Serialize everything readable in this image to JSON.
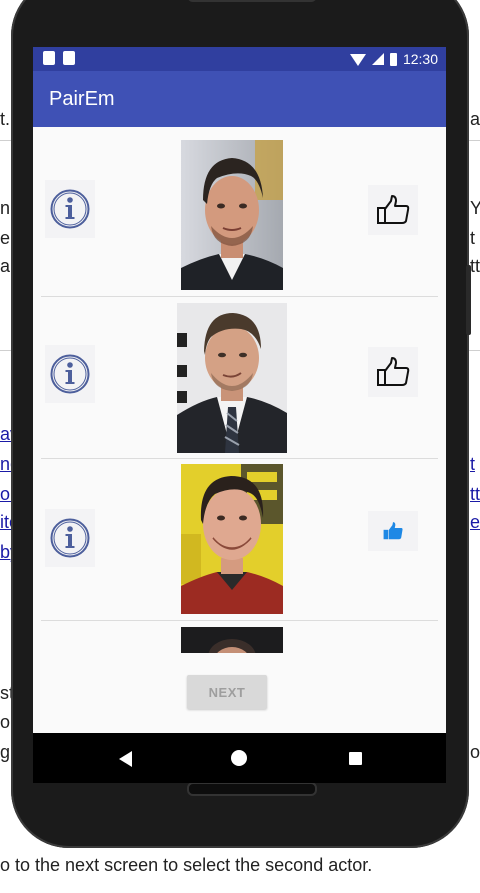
{
  "background_page": {
    "left_fragments": [
      "t.",
      "n",
      "ei",
      "a",
      "av",
      "ne",
      "or",
      "ite",
      "by",
      "st",
      "ou",
      "g"
    ],
    "right_fragments": [
      "a",
      "Y",
      "t",
      "tt",
      "t",
      "tte",
      "e",
      "or"
    ],
    "footer_caption": "o to the next screen to select the second actor."
  },
  "status_bar": {
    "time": "12:30",
    "color": "#303f9f"
  },
  "app_bar": {
    "title": "PairEm",
    "color": "#3f51b5"
  },
  "actors": [
    {
      "info_icon": "info-icon",
      "like_icon": "thumbs-up-outline-icon",
      "liked": false
    },
    {
      "info_icon": "info-icon",
      "like_icon": "thumbs-up-outline-icon",
      "liked": false
    },
    {
      "info_icon": "info-icon",
      "like_icon": "thumbs-up-filled-icon",
      "liked": true
    }
  ],
  "next_button": {
    "label": "NEXT",
    "enabled": false
  },
  "nav_bar": {
    "icons": [
      "back-icon",
      "home-icon",
      "recent-apps-icon"
    ]
  }
}
